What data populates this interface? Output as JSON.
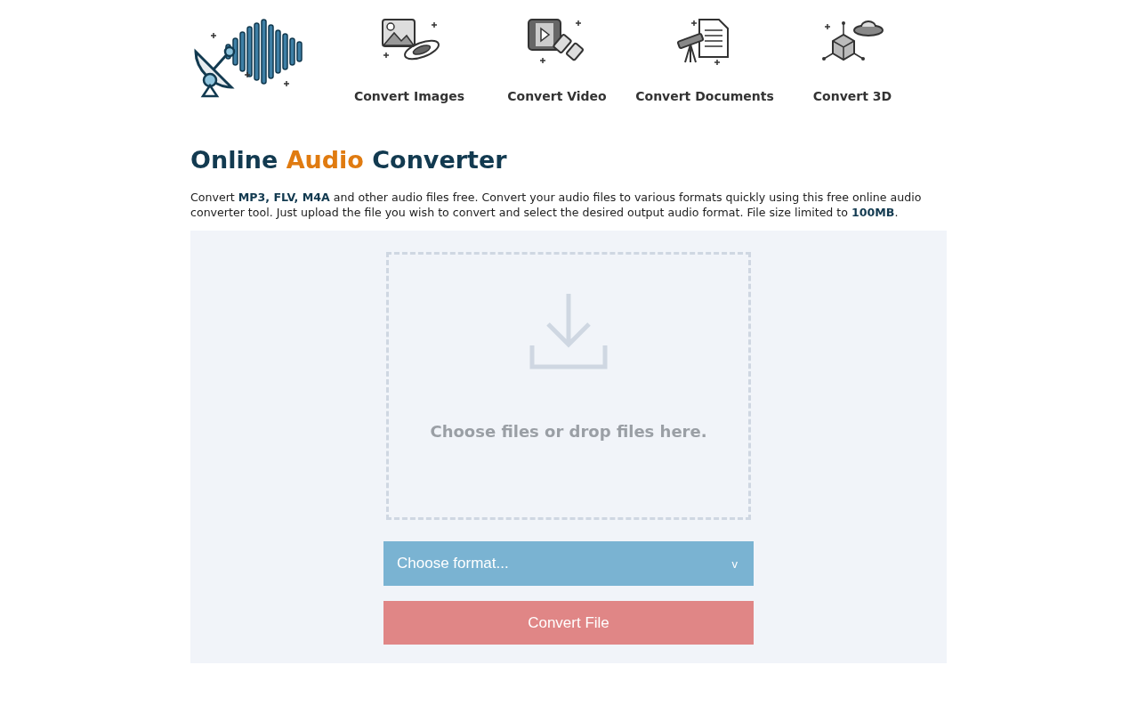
{
  "nav": [
    {
      "label": "Convert Images",
      "kind": "image"
    },
    {
      "label": "Convert Video",
      "kind": "video"
    },
    {
      "label": "Convert Documents",
      "kind": "document"
    },
    {
      "label": "Convert 3D",
      "kind": "cube"
    }
  ],
  "title": [
    {
      "text": "Online ",
      "highlight": false
    },
    {
      "text": "Audio",
      "highlight": true
    },
    {
      "text": " Converter",
      "highlight": false
    }
  ],
  "description": "Convert **MP3, FLV, M4A** and other audio files free. Convert your audio files to various formats quickly using this free online audio converter tool. Just upload the file you wish to convert and select the desired output audio format. File size limited to **100MB**.",
  "dropzone": {
    "text": "Choose files or drop files here."
  },
  "format_select": {
    "placeholder": "Choose format...",
    "caret": "v"
  },
  "convert_button": "Convert File"
}
